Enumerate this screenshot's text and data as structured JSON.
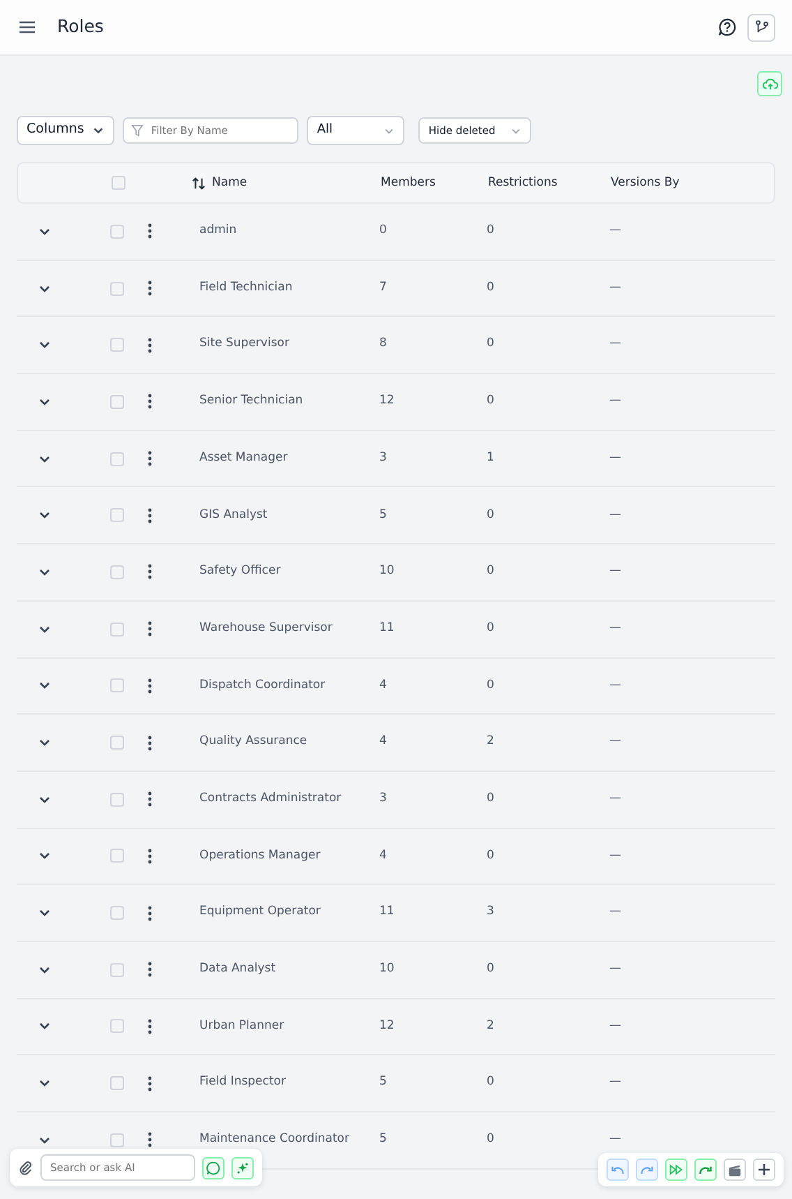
{
  "header": {
    "title": "Roles"
  },
  "toolbar": {
    "columns_button": "Columns",
    "filter": {
      "placeholder": "Filter By Name"
    },
    "scope_select": "All",
    "deleted_select": "Hide deleted"
  },
  "table": {
    "select_all_checked": false,
    "columns": [
      "Name",
      "Members",
      "Restrictions",
      "Versions By"
    ],
    "rows": [
      {
        "name": "admin",
        "members": "0",
        "restrictions": "0",
        "versions_by": "—",
        "checked": false
      },
      {
        "name": "Field Technician",
        "members": "7",
        "restrictions": "0",
        "versions_by": "—",
        "checked": false
      },
      {
        "name": "Site Supervisor",
        "members": "8",
        "restrictions": "0",
        "versions_by": "—",
        "checked": false
      },
      {
        "name": "Senior Technician",
        "members": "12",
        "restrictions": "0",
        "versions_by": "—",
        "checked": false
      },
      {
        "name": "Asset Manager",
        "members": "3",
        "restrictions": "1",
        "versions_by": "—",
        "checked": false
      },
      {
        "name": "GIS Analyst",
        "members": "5",
        "restrictions": "0",
        "versions_by": "—",
        "checked": false
      },
      {
        "name": "Safety Officer",
        "members": "10",
        "restrictions": "0",
        "versions_by": "—",
        "checked": false
      },
      {
        "name": "Warehouse Supervisor",
        "members": "11",
        "restrictions": "0",
        "versions_by": "—",
        "checked": false
      },
      {
        "name": "Dispatch Coordinator",
        "members": "4",
        "restrictions": "0",
        "versions_by": "—",
        "checked": false
      },
      {
        "name": "Quality Assurance",
        "members": "4",
        "restrictions": "2",
        "versions_by": "—",
        "checked": false
      },
      {
        "name": "Contracts Administrator",
        "members": "3",
        "restrictions": "0",
        "versions_by": "—",
        "checked": false
      },
      {
        "name": "Operations Manager",
        "members": "4",
        "restrictions": "0",
        "versions_by": "—",
        "checked": false
      },
      {
        "name": "Equipment Operator",
        "members": "11",
        "restrictions": "3",
        "versions_by": "—",
        "checked": false
      },
      {
        "name": "Data Analyst",
        "members": "10",
        "restrictions": "0",
        "versions_by": "—",
        "checked": false
      },
      {
        "name": "Urban Planner",
        "members": "12",
        "restrictions": "2",
        "versions_by": "—",
        "checked": false
      },
      {
        "name": "Field Inspector",
        "members": "5",
        "restrictions": "0",
        "versions_by": "—",
        "checked": false
      },
      {
        "name": "Maintenance Coordinator",
        "members": "5",
        "restrictions": "0",
        "versions_by": "—",
        "checked": false
      }
    ]
  },
  "ai_bar": {
    "placeholder": "Search or ask AI"
  }
}
